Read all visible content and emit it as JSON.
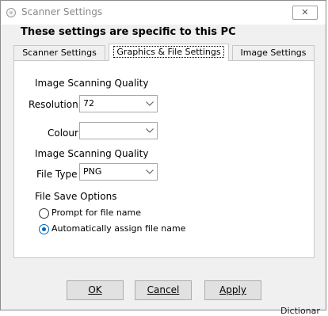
{
  "window": {
    "title": "Scanner Settings",
    "close_glyph": "✕",
    "header": "These settings are specific to this PC"
  },
  "tabs": [
    {
      "label": "Scanner Settings",
      "active": false
    },
    {
      "label": "Graphics & File Settings",
      "active": true
    },
    {
      "label": "Image Settings",
      "active": false
    }
  ],
  "panel": {
    "section1": "Image Scanning Quality",
    "resolution_label": "Resolution",
    "resolution_value": "72",
    "colour_label": "Colour",
    "colour_value": "",
    "section2": "Image Scanning Quality",
    "filetype_label": "File Type",
    "filetype_value": "PNG",
    "section3": "File Save Options",
    "radio_prompt": "Prompt for file name",
    "radio_auto": "Automatically assign file name",
    "selected_option": "Automatically assign file name"
  },
  "buttons": {
    "ok": "OK",
    "cancel": "Cancel",
    "apply": "Apply"
  },
  "background": {
    "partial_text": "Dictionar"
  },
  "colors": {
    "accent": "#0067c0",
    "window_bg": "#f0f0f0"
  },
  "icons": [
    "app-icon",
    "close-icon",
    "chevron-down-icon"
  ]
}
